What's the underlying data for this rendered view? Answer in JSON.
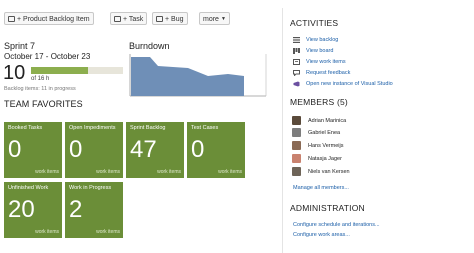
{
  "toolbar": {
    "product_backlog_item": "+ Product Backlog Item",
    "task": "+ Task",
    "bug": "+ Bug",
    "more": "more"
  },
  "sprint": {
    "title": "Sprint 7",
    "dates": "October 17 - October 23",
    "completed": "10",
    "of_total": "of 16 h",
    "progress_fraction": 0.62,
    "backlog_status": "Backlog items: 11 in progress"
  },
  "burndown": {
    "title": "Burndown"
  },
  "team_favorites": {
    "title": "TEAM FAVORITES",
    "unit": "work items",
    "tiles": [
      {
        "label": "Booked Tasks",
        "value": "0"
      },
      {
        "label": "Open Impediments",
        "value": "0"
      },
      {
        "label": "Sprint Backlog",
        "value": "47"
      },
      {
        "label": "Test Cases",
        "value": "0"
      },
      {
        "label": "Unfinished Work",
        "value": "20"
      },
      {
        "label": "Work in Progress",
        "value": "2"
      }
    ]
  },
  "activities": {
    "title": "ACTIVITIES",
    "items": [
      {
        "label": "View backlog",
        "icon": "list-icon"
      },
      {
        "label": "View board",
        "icon": "board-icon"
      },
      {
        "label": "View work items",
        "icon": "work-items-icon"
      },
      {
        "label": "Request feedback",
        "icon": "feedback-icon"
      },
      {
        "label": "Open new instance of Visual Studio",
        "icon": "visual-studio-icon"
      }
    ]
  },
  "members": {
    "title": "MEMBERS (5)",
    "list": [
      {
        "name": "Adrian Marinica"
      },
      {
        "name": "Gabriel Enea"
      },
      {
        "name": "Hans Vermeijs"
      },
      {
        "name": "Natasja Jager"
      },
      {
        "name": "Niels van Kersen"
      }
    ],
    "manage_link": "Manage all members..."
  },
  "administration": {
    "title": "ADMINISTRATION",
    "links": [
      "Configure schedule and iterations...",
      "Configure work areas..."
    ]
  },
  "colors": {
    "tile_green": "#6b8e38",
    "progress_green": "#8cae4e",
    "burndown_area": "#6f8fb7",
    "link_blue": "#1c5fa8"
  }
}
